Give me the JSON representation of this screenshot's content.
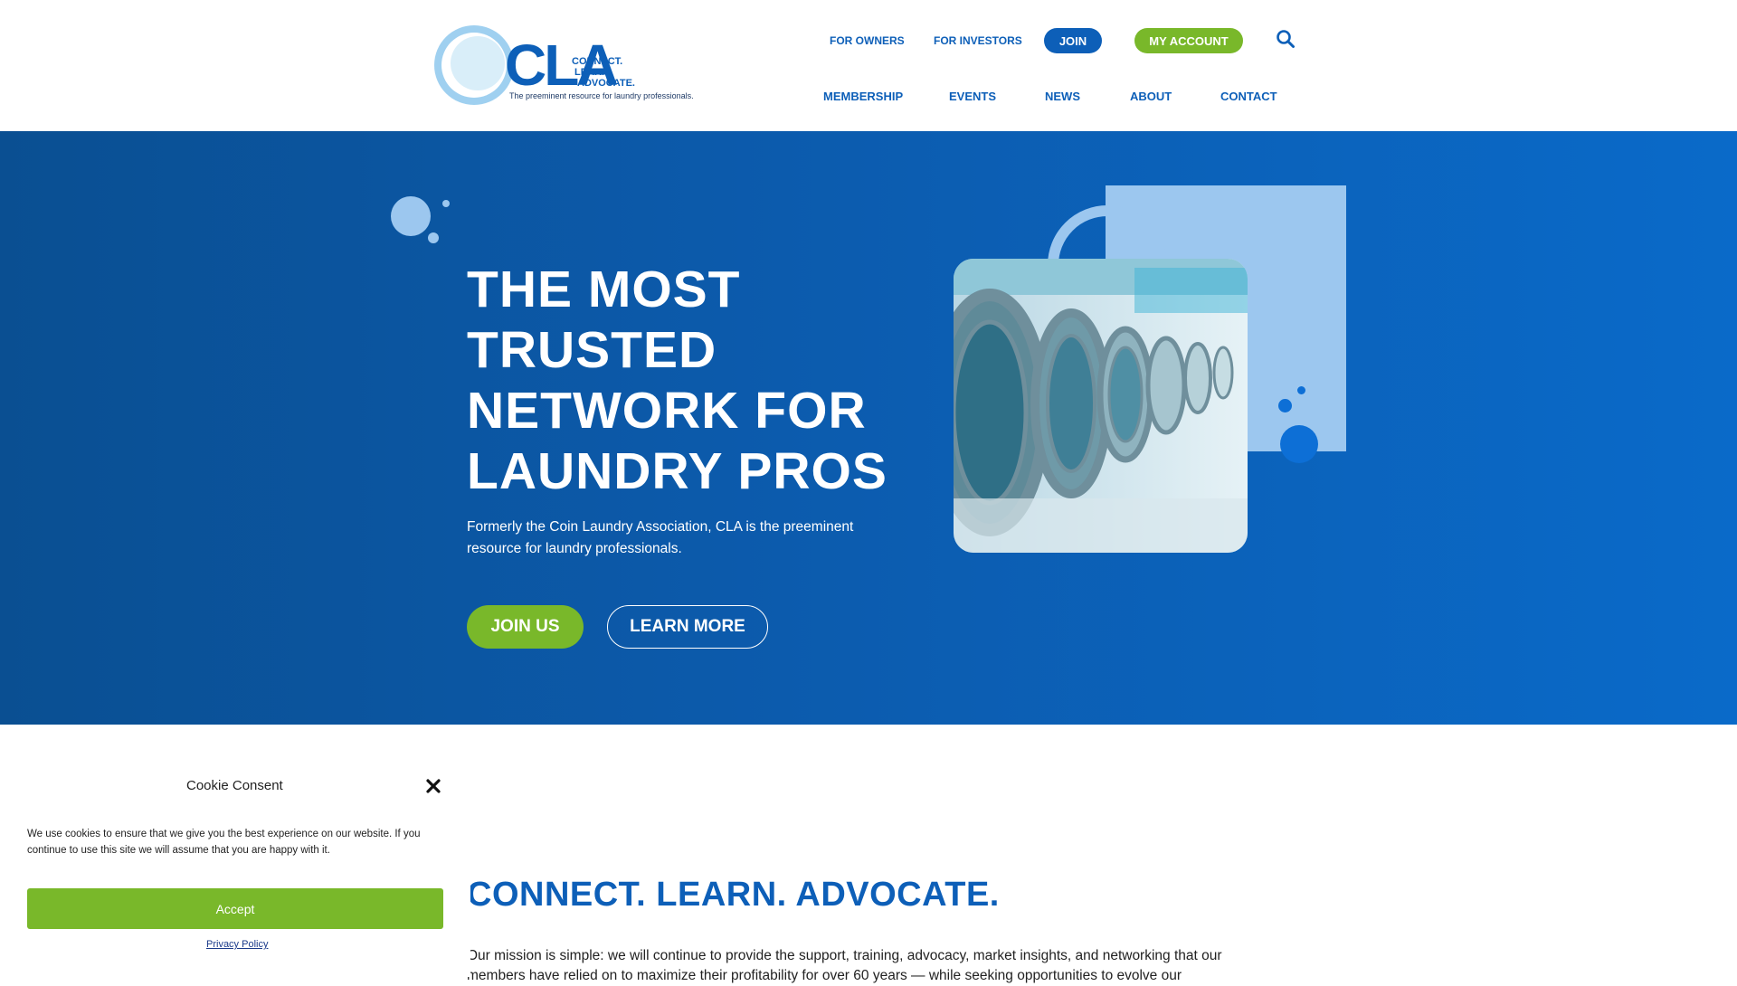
{
  "logo": {
    "wordmark": "CLA",
    "tag_line_1": "CONNECT.",
    "tag_line_2": "LEARN.",
    "tag_line_3": "ADVOCATE.",
    "tagline": "The preeminent resource for laundry professionals."
  },
  "utility_nav": {
    "owners": "FOR OWNERS",
    "investors": "FOR INVESTORS",
    "join": "JOIN",
    "account": "MY ACCOUNT",
    "search_icon": "search-icon"
  },
  "main_nav": {
    "membership": "MEMBERSHIP",
    "events": "EVENTS",
    "news": "NEWS",
    "about": "ABOUT",
    "contact": "CONTACT"
  },
  "hero": {
    "title_line_1": "THE MOST",
    "title_line_2": "TRUSTED",
    "title_line_3": "NETWORK FOR",
    "title_line_4": "LAUNDRY PROS",
    "description": "Formerly the Coin Laundry Association, CLA is the preeminent resource for laundry professionals.",
    "join_button": "JOIN US",
    "learn_button": "LEARN MORE"
  },
  "cookie": {
    "title": "Cookie Consent",
    "text": "We use cookies to ensure that we give you the best experience on our website. If you continue to use this site we will assume that you are happy with it.",
    "accept": "Accept",
    "privacy": "Privacy Policy"
  },
  "mission": {
    "title": "CONNECT. LEARN. ADVOCATE.",
    "text": "Our mission is simple: we will continue to provide the support, training, advocacy, market insights, and networking that our members have relied on to maximize their profitability for over 60 years — while seeking opportunities to evolve our"
  },
  "colors": {
    "brand_blue": "#0d5fb8",
    "brand_green": "#79b82a",
    "light_blue": "#9cc7ef"
  }
}
